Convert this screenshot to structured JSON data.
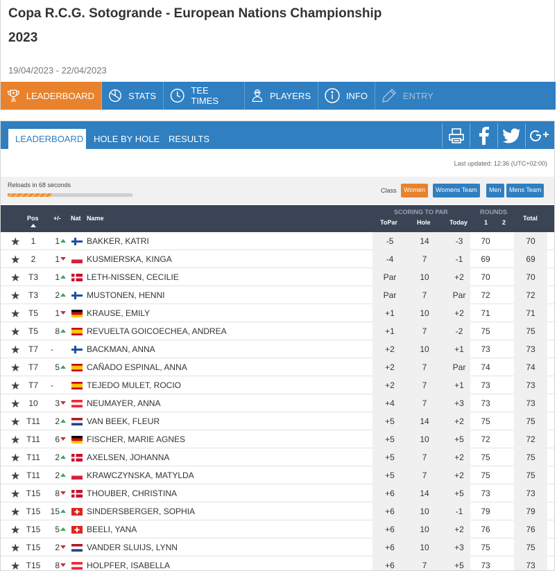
{
  "event": {
    "title": "Copa R.C.G. Sotogrande - European Nations Championship 2023",
    "dates": "19/04/2023 - 22/04/2023"
  },
  "main_nav": [
    {
      "label": "LEADERBOARD",
      "icon": "trophy-icon",
      "state": "active"
    },
    {
      "label": "STATS",
      "icon": "pie-chart-icon",
      "state": "normal"
    },
    {
      "label": "TEE TIMES",
      "icon": "clock-icon",
      "state": "normal"
    },
    {
      "label": "PLAYERS",
      "icon": "player-icon",
      "state": "normal"
    },
    {
      "label": "INFO",
      "icon": "info-icon",
      "state": "normal"
    },
    {
      "label": "ENTRY",
      "icon": "pen-icon",
      "state": "disabled"
    }
  ],
  "sub_nav": {
    "tabs": [
      {
        "label": "LEADERBOARD",
        "active": true
      },
      {
        "label": "HOLE BY HOLE",
        "active": false
      },
      {
        "label": "RESULTS",
        "active": false
      }
    ],
    "share_icons": [
      "print-icon",
      "facebook-icon",
      "twitter-icon",
      "google-plus-icon"
    ]
  },
  "status": {
    "last_updated": "Last updated: 12:36 (UTC+02:00)",
    "reload_text": "Reloads in 68 seconds",
    "reload_progress": 0.35
  },
  "class_filter": {
    "label": "Class",
    "options": [
      {
        "label": "Women",
        "active": true
      },
      {
        "label": "Womens Team",
        "active": false
      },
      {
        "label": "Men",
        "active": false
      },
      {
        "label": "Mens Team",
        "active": false
      }
    ]
  },
  "table": {
    "headers": {
      "pos": "Pos",
      "move": "+/-",
      "nat": "Nat",
      "name": "Name",
      "scoring_group": "SCORING TO PAR",
      "topar": "ToPar",
      "hole": "Hole",
      "today": "Today",
      "rounds_group": "ROUNDS",
      "r1": "1",
      "r2": "2",
      "total": "Total"
    },
    "rows": [
      {
        "pos": "1",
        "move": "1",
        "dir": "up",
        "nat": "FIN",
        "name": "BAKKER, KATRI",
        "topar": "-5",
        "hole": "14",
        "today": "-3",
        "r1": "70",
        "r2": "",
        "total": "70"
      },
      {
        "pos": "2",
        "move": "1",
        "dir": "down",
        "nat": "POL",
        "name": "KUSMIERSKA, KINGA",
        "topar": "-4",
        "hole": "7",
        "today": "-1",
        "r1": "69",
        "r2": "",
        "total": "69"
      },
      {
        "pos": "T3",
        "move": "1",
        "dir": "up",
        "nat": "DEN",
        "name": "LETH-NISSEN, CECILIE",
        "topar": "Par",
        "hole": "10",
        "today": "+2",
        "r1": "70",
        "r2": "",
        "total": "70"
      },
      {
        "pos": "T3",
        "move": "2",
        "dir": "up",
        "nat": "FIN",
        "name": "MUSTONEN, HENNI",
        "topar": "Par",
        "hole": "7",
        "today": "Par",
        "r1": "72",
        "r2": "",
        "total": "72"
      },
      {
        "pos": "T5",
        "move": "1",
        "dir": "down",
        "nat": "GER",
        "name": "KRAUSE, EMILY",
        "topar": "+1",
        "hole": "10",
        "today": "+2",
        "r1": "71",
        "r2": "",
        "total": "71"
      },
      {
        "pos": "T5",
        "move": "8",
        "dir": "up",
        "nat": "ESP",
        "name": "REVUELTA GOICOECHEA, ANDREA",
        "topar": "+1",
        "hole": "7",
        "today": "-2",
        "r1": "75",
        "r2": "",
        "total": "75"
      },
      {
        "pos": "T7",
        "move": "-",
        "dir": "none",
        "nat": "FIN",
        "name": "BACKMAN, ANNA",
        "topar": "+2",
        "hole": "10",
        "today": "+1",
        "r1": "73",
        "r2": "",
        "total": "73"
      },
      {
        "pos": "T7",
        "move": "5",
        "dir": "up",
        "nat": "ESP",
        "name": "CAÑADO ESPINAL, ANNA",
        "topar": "+2",
        "hole": "7",
        "today": "Par",
        "r1": "74",
        "r2": "",
        "total": "74"
      },
      {
        "pos": "T7",
        "move": "-",
        "dir": "none",
        "nat": "ESP",
        "name": "TEJEDO MULET, ROCIO",
        "topar": "+2",
        "hole": "7",
        "today": "+1",
        "r1": "73",
        "r2": "",
        "total": "73"
      },
      {
        "pos": "10",
        "move": "3",
        "dir": "down",
        "nat": "AUT",
        "name": "NEUMAYER, ANNA",
        "topar": "+4",
        "hole": "7",
        "today": "+3",
        "r1": "73",
        "r2": "",
        "total": "73"
      },
      {
        "pos": "T11",
        "move": "2",
        "dir": "up",
        "nat": "NED",
        "name": "VAN BEEK, FLEUR",
        "topar": "+5",
        "hole": "14",
        "today": "+2",
        "r1": "75",
        "r2": "",
        "total": "75"
      },
      {
        "pos": "T11",
        "move": "6",
        "dir": "down",
        "nat": "GER",
        "name": "FISCHER, MARIE AGNES",
        "topar": "+5",
        "hole": "10",
        "today": "+5",
        "r1": "72",
        "r2": "",
        "total": "72"
      },
      {
        "pos": "T11",
        "move": "2",
        "dir": "up",
        "nat": "DEN",
        "name": "AXELSEN, JOHANNA",
        "topar": "+5",
        "hole": "7",
        "today": "+2",
        "r1": "75",
        "r2": "",
        "total": "75"
      },
      {
        "pos": "T11",
        "move": "2",
        "dir": "up",
        "nat": "POL",
        "name": "KRAWCZYNSKA, MATYLDA",
        "topar": "+5",
        "hole": "7",
        "today": "+2",
        "r1": "75",
        "r2": "",
        "total": "75"
      },
      {
        "pos": "T15",
        "move": "8",
        "dir": "down",
        "nat": "DEN",
        "name": "THOUBER, CHRISTINA",
        "topar": "+6",
        "hole": "14",
        "today": "+5",
        "r1": "73",
        "r2": "",
        "total": "73"
      },
      {
        "pos": "T15",
        "move": "15",
        "dir": "up",
        "nat": "SUI",
        "name": "SINDERSBERGER, SOPHIA",
        "topar": "+6",
        "hole": "10",
        "today": "-1",
        "r1": "79",
        "r2": "",
        "total": "79"
      },
      {
        "pos": "T15",
        "move": "5",
        "dir": "up",
        "nat": "SUI",
        "name": "BEELI, YANA",
        "topar": "+6",
        "hole": "10",
        "today": "+2",
        "r1": "76",
        "r2": "",
        "total": "76"
      },
      {
        "pos": "T15",
        "move": "2",
        "dir": "down",
        "nat": "NED",
        "name": "VANDER SLUIJS, LYNN",
        "topar": "+6",
        "hole": "10",
        "today": "+3",
        "r1": "75",
        "r2": "",
        "total": "75"
      },
      {
        "pos": "T15",
        "move": "8",
        "dir": "down",
        "nat": "AUT",
        "name": "HOLPFER, ISABELLA",
        "topar": "+6",
        "hole": "7",
        "today": "+5",
        "r1": "73",
        "r2": "",
        "total": "73"
      }
    ]
  },
  "colors": {
    "nav_blue": "#2f7fc1",
    "active_orange": "#e8822c",
    "header_dark": "#3a4454",
    "up_green": "#3aa655",
    "down_red": "#c9302c"
  }
}
